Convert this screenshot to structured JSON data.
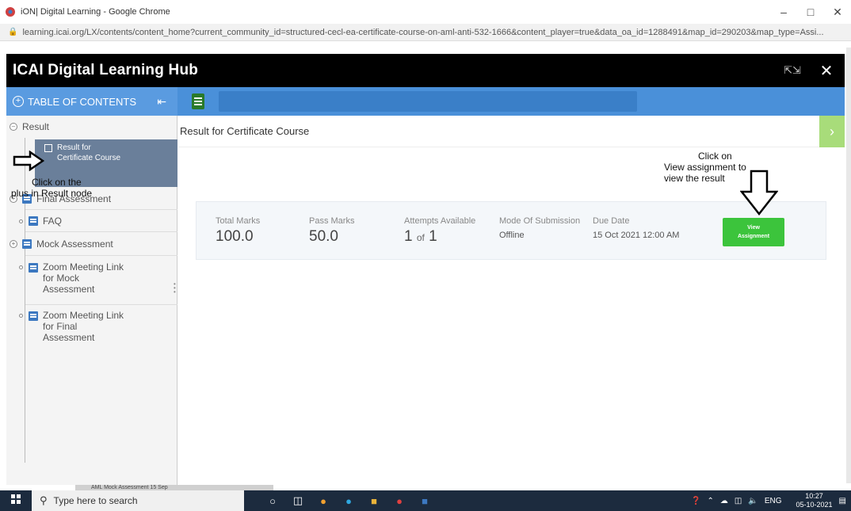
{
  "browser": {
    "window_title": "iON| Digital Learning - Google Chrome",
    "url": "learning.icai.org/LX/contents/content_home?current_community_id=structured-cecl-ea-certificate-course-on-aml-anti-532-1666&content_player=true&data_oa_id=1288491&map_id=290203&map_type=Assi..."
  },
  "app": {
    "title": "ICAI Digital Learning Hub"
  },
  "toolbar": {
    "toc_label": "TABLE OF CONTENTS"
  },
  "sidebar": {
    "items": [
      {
        "label": "Result"
      },
      {
        "label": "Result for Certificate Course"
      },
      {
        "label": "Final Assessment"
      },
      {
        "label": "FAQ"
      },
      {
        "label": "Mock Assessment"
      },
      {
        "label": "Zoom Meeting Link for Mock Assessment"
      },
      {
        "label": "Zoom Meeting Link for Final Assessment"
      }
    ],
    "selected_line1": "Result for",
    "selected_line2": "Certificate Course",
    "zoom_mock_l1": "Zoom Meeting Link",
    "zoom_mock_l2": "for Mock",
    "zoom_mock_l3": "Assessment",
    "zoom_final_l1": "Zoom Meeting Link",
    "zoom_final_l2": "for Final",
    "zoom_final_l3": "Assessment"
  },
  "main": {
    "breadcrumb": "Result for Certificate Course",
    "result": {
      "total_marks_label": "Total Marks",
      "total_marks": "100.0",
      "pass_marks_label": "Pass Marks",
      "pass_marks": "50.0",
      "attempts_label": "Attempts Available",
      "attempts_used": "1",
      "attempts_of": "of",
      "attempts_total": "1",
      "mode_label": "Mode Of Submission",
      "mode": "Offline",
      "due_label": "Due Date",
      "due": "15 Oct 2021 12:00 AM",
      "button_line1": "View",
      "button_line2": "Assignment"
    }
  },
  "annotations": {
    "left_note_1": "Click on the",
    "left_note_2": "plus in Result node",
    "right_note_1": "Click on",
    "right_note_2": "View assignment to",
    "right_note_3": "view the result"
  },
  "taskbar": {
    "search_placeholder": "Type here to search",
    "lang": "ENG",
    "time": "10:27",
    "date": "05-10-2021",
    "behind_window": "AML Mock Assessment 15 Sep"
  },
  "colors": {
    "header_bg": "#000000",
    "toolbar_bg": "#4a90d9",
    "button_green": "#3cc43c",
    "selected_bg": "#6a7f9a"
  }
}
